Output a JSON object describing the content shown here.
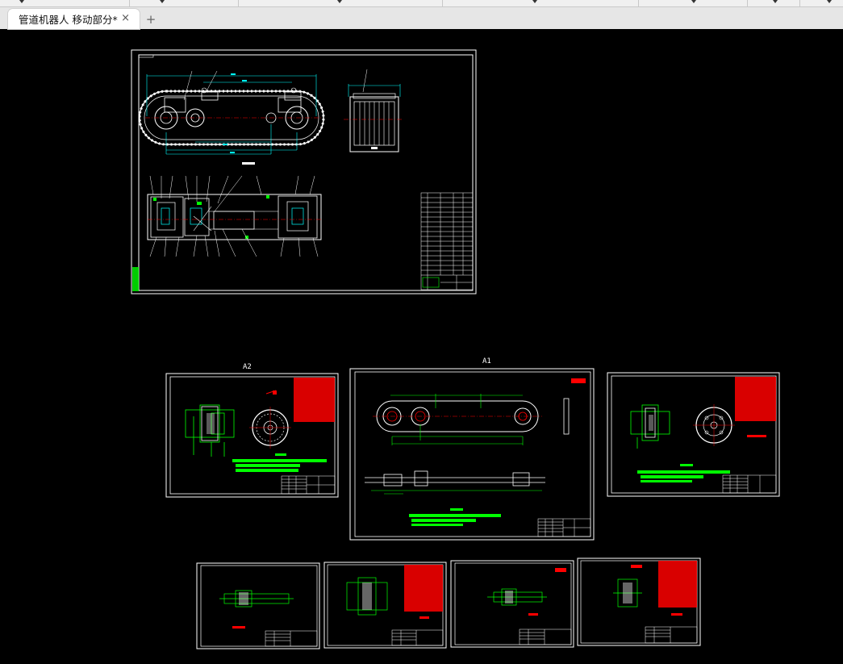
{
  "tab": {
    "title": "管道机器人 移动部分*",
    "close_icon": "×",
    "add_icon": "+"
  },
  "colors": {
    "background": "#000000",
    "frame": "#ffffff",
    "geometry": "#ffffff",
    "dimension": "#00ffff",
    "centerline": "#ff0000",
    "notes": "#00ff00",
    "title_block_red": "#ff0000"
  },
  "sheets": {
    "assembly": {
      "label": ""
    },
    "a2": {
      "label": "A2"
    },
    "a1": {
      "label": "A1"
    }
  }
}
